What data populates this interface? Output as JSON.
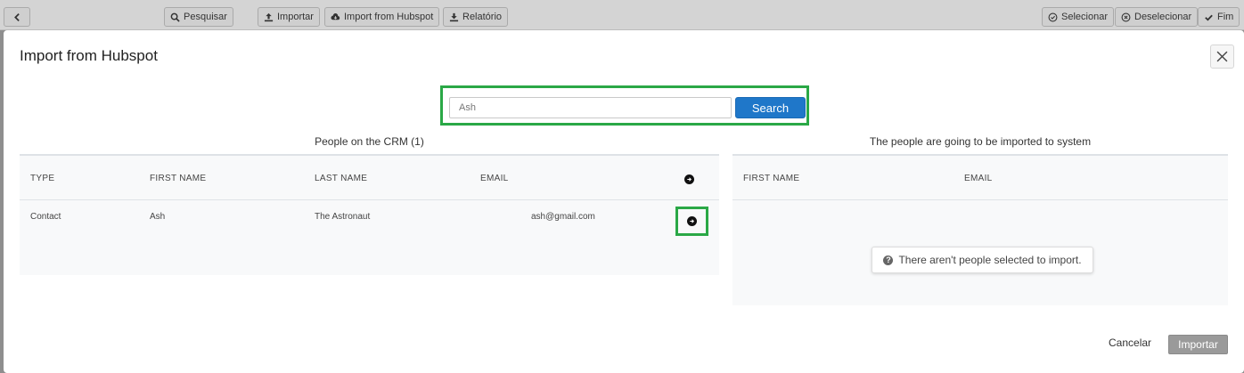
{
  "toolbar": {
    "back_label": "<",
    "search_label": "Pesquisar",
    "import_label": "Importar",
    "import_hubspot_label": "Import from Hubspot",
    "report_label": "Relatório",
    "select_label": "Selecionar",
    "deselect_label": "Deselecionar",
    "end_label": "Fim"
  },
  "modal": {
    "title": "Import from Hubspot",
    "search": {
      "value": "Ash",
      "button_label": "Search"
    },
    "left": {
      "title": "People on the CRM (1)",
      "columns": [
        "TYPE",
        "FIRST NAME",
        "LAST NAME",
        "EMAIL"
      ],
      "rows": [
        {
          "type": "Contact",
          "first_name": "Ash",
          "last_name": "The Astronaut",
          "email": "ash@gmail.com"
        }
      ]
    },
    "right": {
      "title": "The people are going to be imported to system",
      "columns": [
        "FIRST NAME",
        "EMAIL"
      ],
      "empty_message": "There aren't people selected to import."
    },
    "footer": {
      "cancel_label": "Cancelar",
      "import_label": "Importar"
    }
  },
  "colors": {
    "accent": "#1f77c9",
    "highlight": "#2aa846",
    "disabled_button": "#9a9a9a"
  }
}
